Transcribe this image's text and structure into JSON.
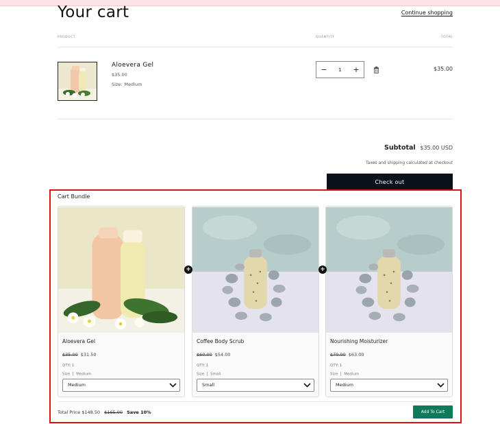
{
  "page": {
    "title": "Your cart",
    "continue_link": "Continue shopping"
  },
  "table_head": {
    "product": "PRODUCT",
    "quantity": "QUANTITY",
    "total": "TOTAL"
  },
  "cart_item": {
    "name": "Aloevera Gel",
    "price": "$35.00",
    "size_label": "Size:",
    "size_value": "Medium",
    "quantity": "1",
    "minus": "−",
    "plus": "+",
    "line_total": "$35.00"
  },
  "summary": {
    "subtotal_label": "Subtotal",
    "subtotal_value": "$35.00 USD",
    "taxes_note": "Taxes and shipping calculated at checkout",
    "checkout_label": "Check out"
  },
  "bundle": {
    "title": "Cart Bundle",
    "products": [
      {
        "name": "Aloevera Gel",
        "old_price": "$35.00",
        "price": "$31.50",
        "qty": "QTY: 1",
        "size_label": "Size",
        "size_value": "Medium",
        "select_value": "Medium"
      },
      {
        "name": "Coffee Body Scrub",
        "old_price": "$60.00",
        "price": "$54.00",
        "qty": "QTY: 1",
        "size_label": "Size",
        "size_value": "Small",
        "select_value": "Small"
      },
      {
        "name": "Nourishing Moisturizer",
        "old_price": "$70.00",
        "price": "$63.00",
        "qty": "QTY: 1",
        "size_label": "Size",
        "size_value": "Medium",
        "select_value": "Medium"
      }
    ],
    "plus_glyph": "+",
    "total_label": "Total Price",
    "total_price": "$148.50",
    "total_old": "$165.00",
    "save_text": "Save 10%",
    "add_to_cart": "Add To Cart"
  },
  "colors": {
    "checkout_bg": "#0b121c",
    "add_to_cart_bg": "#0e7a5a",
    "highlight_border": "#e01010"
  }
}
